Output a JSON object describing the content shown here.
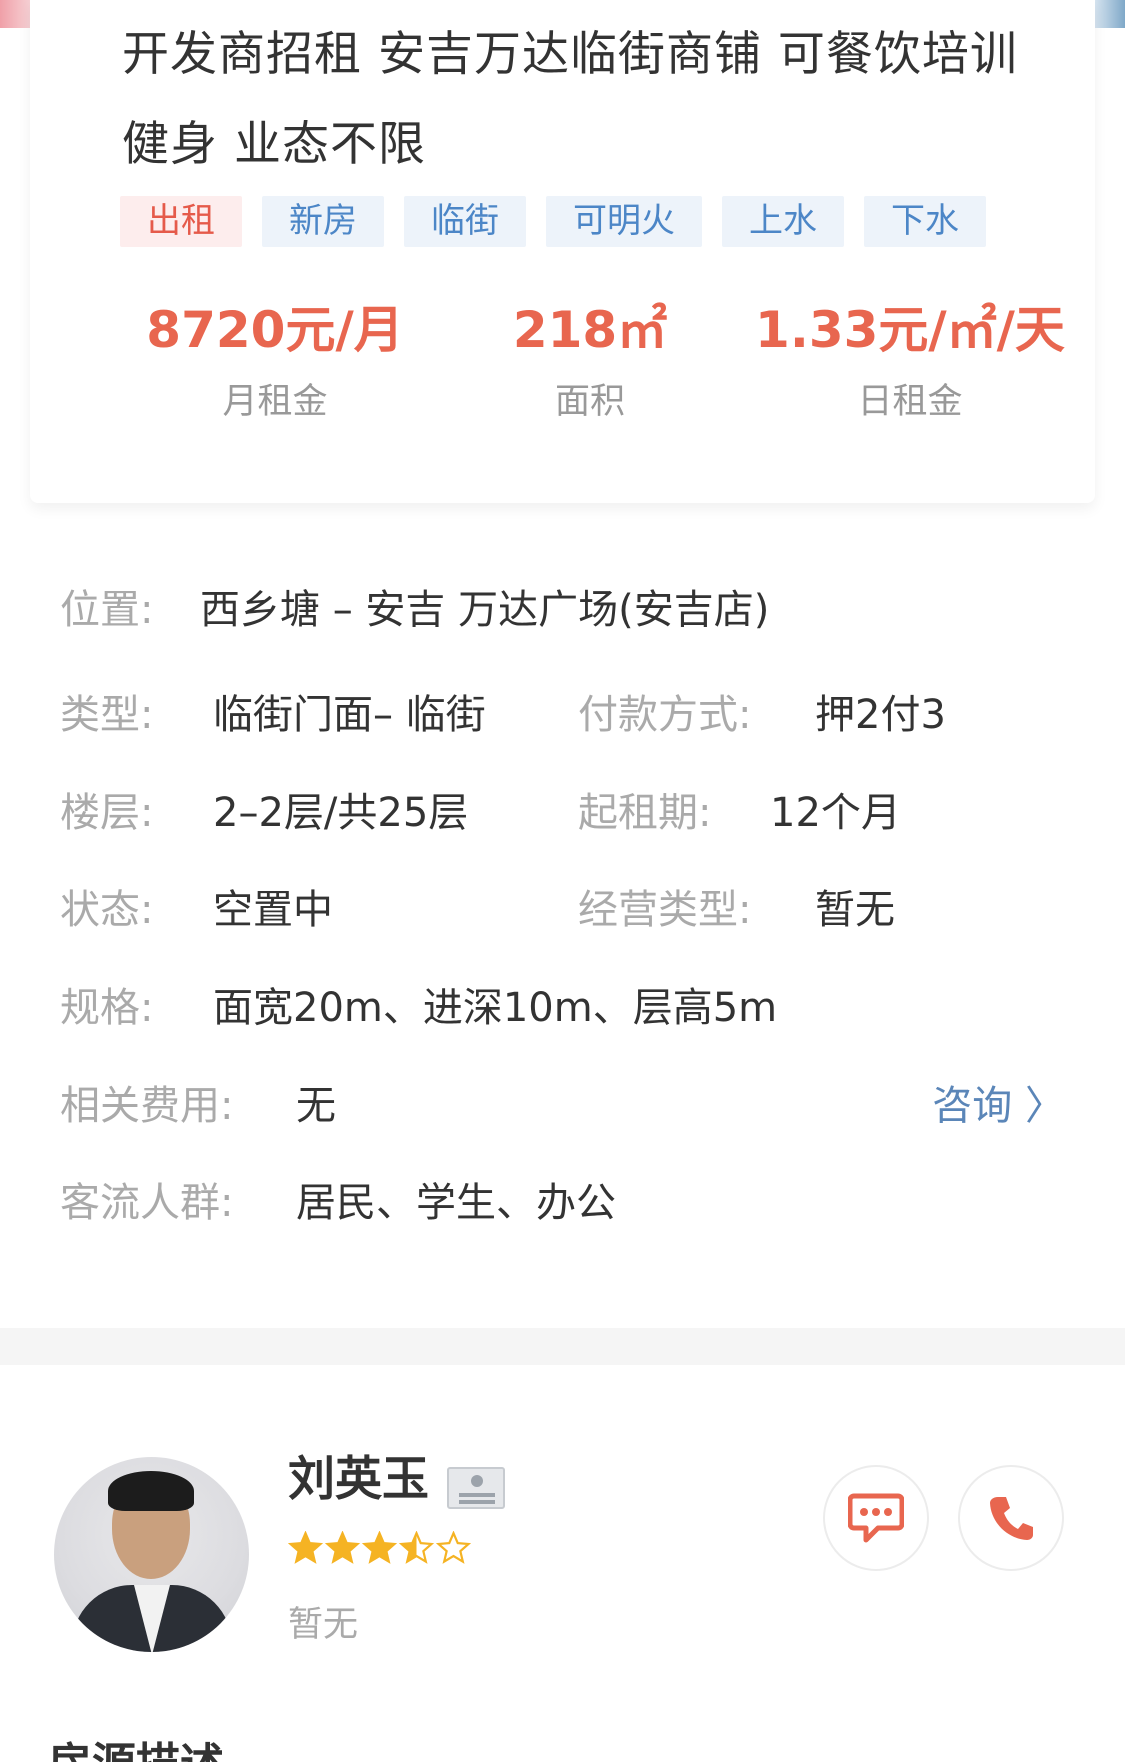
{
  "listing": {
    "title": "开发商招租  安吉万达临街商铺 可餐饮培训健身  业态不限",
    "tags": [
      {
        "label": "出租",
        "kind": "rent"
      },
      {
        "label": "新房",
        "kind": "feature"
      },
      {
        "label": "临街",
        "kind": "feature"
      },
      {
        "label": "可明火",
        "kind": "feature"
      },
      {
        "label": "上水",
        "kind": "feature"
      },
      {
        "label": "下水",
        "kind": "feature"
      }
    ],
    "stats": {
      "monthly_rent": {
        "value": "8720元/月",
        "label": "月租金"
      },
      "area": {
        "value": "218㎡",
        "label": "面积"
      },
      "daily_rent": {
        "value": "1.33元/㎡/天",
        "label": "日租金"
      }
    }
  },
  "details": {
    "location": {
      "label": "位置:",
      "value": "西乡塘 – 安吉 万达广场(安吉店)"
    },
    "type": {
      "label": "类型:",
      "value": "临街门面– 临街"
    },
    "payment": {
      "label": "付款方式:",
      "value": "押2付3"
    },
    "floor": {
      "label": "楼层:",
      "value": "2–2层/共25层"
    },
    "min_lease": {
      "label": "起租期:",
      "value": "12个月"
    },
    "status": {
      "label": "状态:",
      "value": "空置中"
    },
    "business_type": {
      "label": "经营类型:",
      "value": "暂无"
    },
    "spec": {
      "label": "规格:",
      "value": "面宽20m、进深10m、层高5m"
    },
    "fees": {
      "label": "相关费用:",
      "value": "无",
      "action": "咨询 〉"
    },
    "customers": {
      "label": "客流人群:",
      "value": "居民、学生、办公"
    }
  },
  "agent": {
    "name": "刘英玉",
    "rating": 3.5,
    "rating_max": 5,
    "subtitle": "暂无",
    "accent": "#e8664f"
  },
  "section": {
    "title": "房源描述"
  },
  "colors": {
    "price": "#e8664f",
    "tag_bg": "#edf3fa",
    "tag_text": "#4c86c7",
    "rent_tag_bg": "#fdeded",
    "rent_tag_text": "#e55a4a",
    "link": "#5b86b8",
    "star": "#f5b323"
  }
}
